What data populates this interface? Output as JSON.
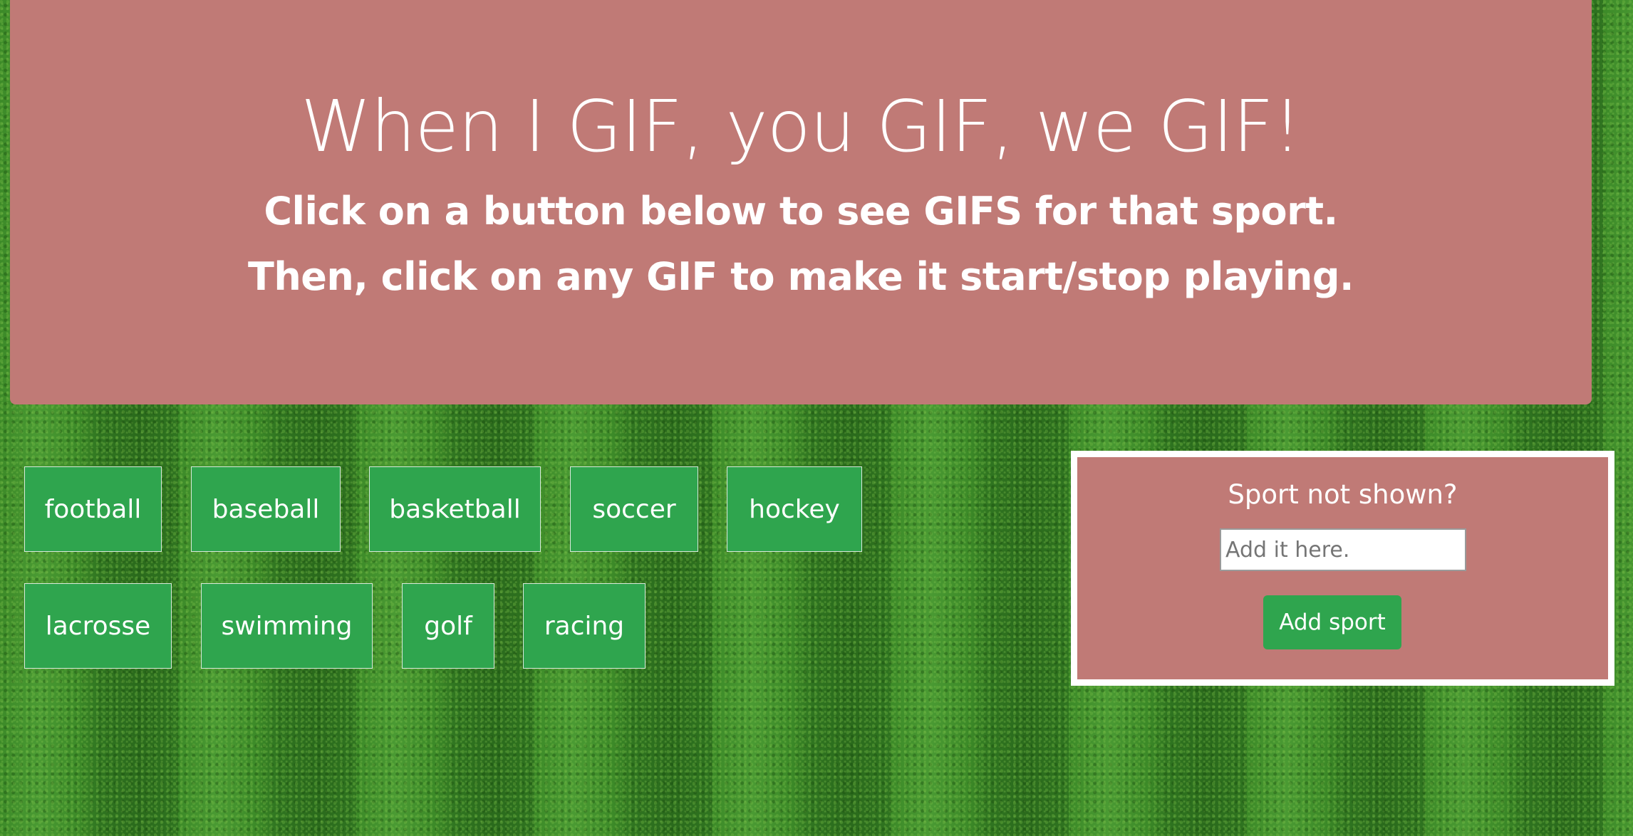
{
  "header": {
    "title": "When I GIF, you GIF, we GIF!",
    "line1": "Click on a button below to see GIFS for that sport.",
    "line2": "Then, click on any GIF to make it start/stop playing."
  },
  "sports": [
    {
      "label": "football"
    },
    {
      "label": "baseball"
    },
    {
      "label": "basketball"
    },
    {
      "label": "soccer"
    },
    {
      "label": "hockey"
    },
    {
      "label": "lacrosse"
    },
    {
      "label": "swimming"
    },
    {
      "label": "golf"
    },
    {
      "label": "racing"
    }
  ],
  "add_panel": {
    "title": "Sport not shown?",
    "input_placeholder": "Add it here.",
    "input_value": "",
    "button_label": "Add sport"
  },
  "colors": {
    "panel": "#c07a76",
    "button": "#2fa54e",
    "text": "#ffffff",
    "field_background": "grass-green"
  }
}
